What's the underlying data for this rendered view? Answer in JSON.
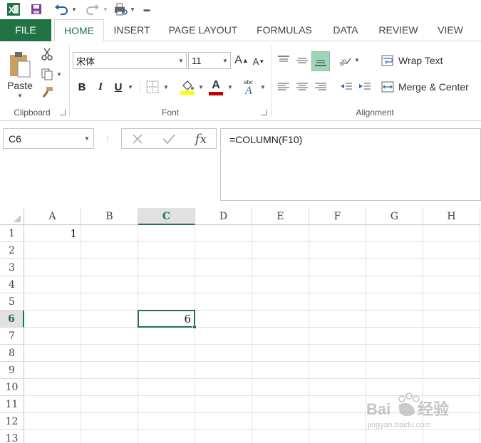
{
  "qat": {
    "save_tip": "Save",
    "undo_tip": "Undo",
    "redo_tip": "Redo"
  },
  "tabs": [
    {
      "label": "FILE"
    },
    {
      "label": "HOME"
    },
    {
      "label": "INSERT"
    },
    {
      "label": "PAGE LAYOUT"
    },
    {
      "label": "FORMULAS"
    },
    {
      "label": "DATA"
    },
    {
      "label": "REVIEW"
    },
    {
      "label": "VIEW"
    }
  ],
  "ribbon": {
    "clipboard": {
      "label": "Clipboard",
      "paste_label": "Paste"
    },
    "font": {
      "label": "Font",
      "font_name": "宋体",
      "font_size": "11",
      "bold": "B",
      "italic": "I",
      "underline": "U",
      "grow": "A",
      "shrink": "A"
    },
    "alignment": {
      "label": "Alignment",
      "wrap_text": "Wrap Text",
      "merge_center": "Merge & Center"
    }
  },
  "formula_bar": {
    "name_box": "C6",
    "fx": "fx",
    "formula": "=COLUMN(F10)"
  },
  "grid": {
    "columns": [
      "A",
      "B",
      "C",
      "D",
      "E",
      "F",
      "G",
      "H"
    ],
    "rows": [
      "1",
      "2",
      "3",
      "4",
      "5",
      "6",
      "7",
      "8",
      "9",
      "10",
      "11",
      "12",
      "13"
    ],
    "selected_column": "C",
    "selected_row": "6",
    "cells": {
      "A1": "1",
      "C6": "6"
    }
  },
  "colors": {
    "accent": "#217346",
    "font_color_bar": "#c00000",
    "fill_color_bar": "#ffff00"
  }
}
